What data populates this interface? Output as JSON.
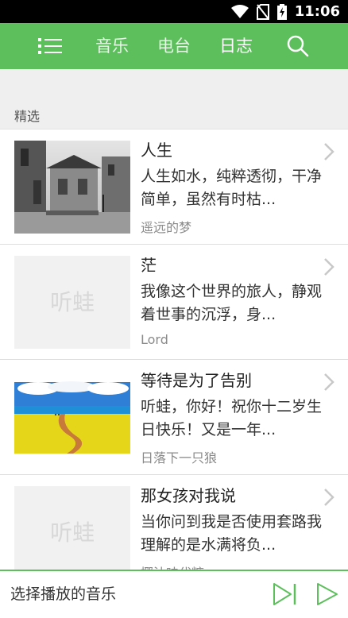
{
  "status_bar": {
    "time": "11:06"
  },
  "nav": {
    "tabs": [
      {
        "label": "音乐"
      },
      {
        "label": "电台"
      },
      {
        "label": "日志",
        "active": true
      }
    ]
  },
  "section": {
    "label": "精选"
  },
  "items": [
    {
      "title": "人生",
      "description": "人生如水，纯粹透彻，干净简单，虽然有时枯...",
      "author": "遥远的梦"
    },
    {
      "title": "茫",
      "description": "我像这个世界的旅人，静观着世事的沉浮，身...",
      "author": "Lord",
      "placeholder_text": "听蛙"
    },
    {
      "title": "等待是为了告别",
      "description": "听蛙，你好！祝你十二岁生日快乐！又是一年...",
      "author": "日落下一只狼"
    },
    {
      "title": "那女孩对我说",
      "description": "当你问到我是否使用套路我理解的是水满将负...",
      "author": "椰汁味代糖",
      "placeholder_text": "听蛙"
    }
  ],
  "player": {
    "label": "选择播放的音乐"
  },
  "colors": {
    "accent": "#5cbf5c",
    "status_bar": "#000000"
  }
}
